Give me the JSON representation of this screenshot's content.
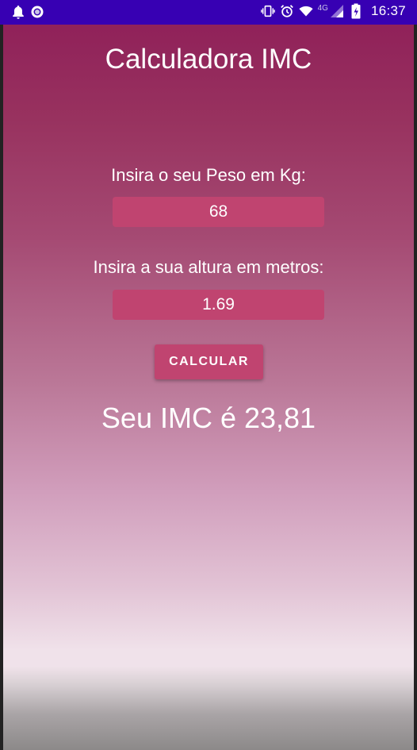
{
  "status_bar": {
    "time": "16:37",
    "network": "4G",
    "left_icons": [
      "notification-bell-icon",
      "circle-app-icon"
    ],
    "right_icons": [
      "vibrate-icon",
      "alarm-icon",
      "wifi-icon",
      "signal-icon",
      "battery-icon"
    ]
  },
  "app": {
    "title": "Calculadora IMC",
    "weight_label": "Insira o seu Peso em Kg:",
    "weight_value": "68",
    "height_label": "Insira a sua altura em metros:",
    "height_value": "1.69",
    "calculate_button": "CALCULAR",
    "result": "Seu IMC é 23,81"
  },
  "colors": {
    "status_bar": "#3700b3",
    "accent": "#c04470",
    "gradient_top": "#8e1d58",
    "gradient_bottom": "#f0e2ea"
  }
}
